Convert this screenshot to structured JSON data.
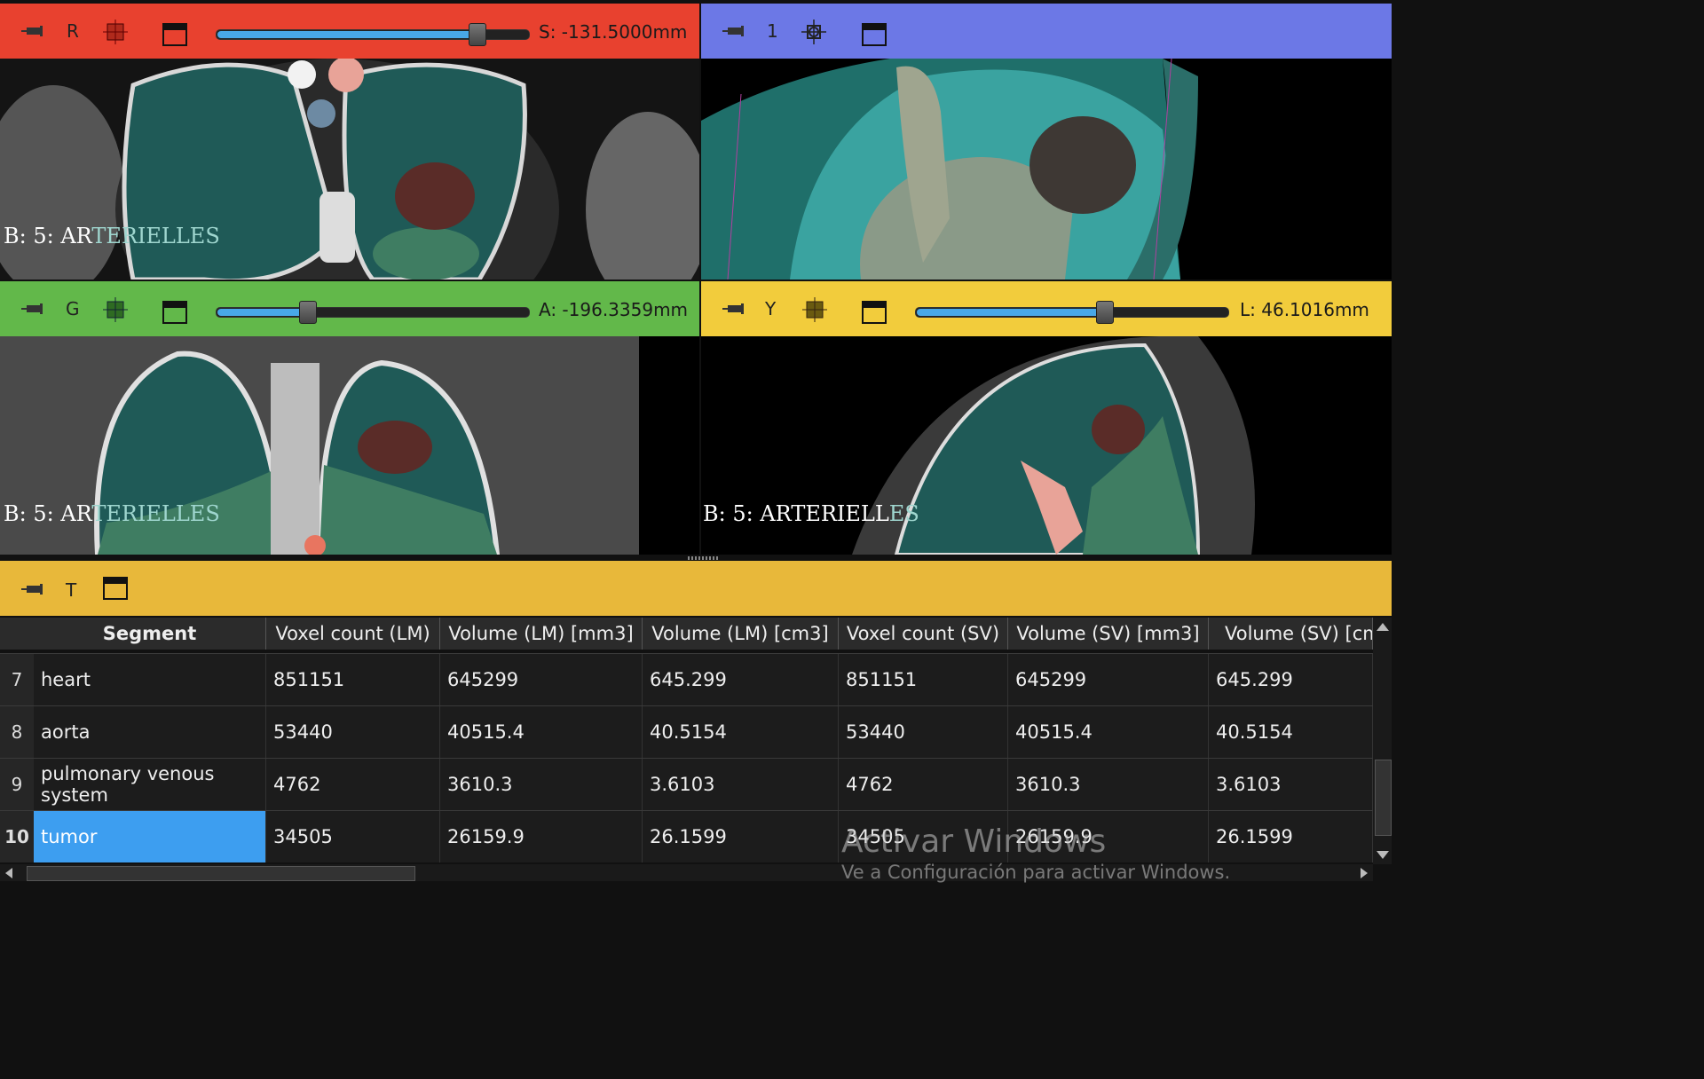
{
  "views": {
    "red": {
      "letter": "R",
      "readout": "S: -131.5000mm",
      "label_a": "B: 5: AR",
      "label_b": "TERIELLES",
      "slider_pos": 0.83
    },
    "threed": {
      "letter": "1"
    },
    "green": {
      "letter": "G",
      "readout": "A: -196.3359mm",
      "label_a": "B: 5: AR",
      "label_b": "TERIELLES",
      "slider_pos": 0.29
    },
    "yellow": {
      "letter": "Y",
      "readout": "L: 46.1016mm",
      "label_a": "B: 5: ARTERIELL",
      "label_b": "ES",
      "slider_pos": 0.6
    }
  },
  "table_view": {
    "letter": "T",
    "headers": [
      "Segment",
      "Voxel count (LM)",
      "Volume (LM) [mm3]",
      "Volume (LM) [cm3]",
      "Voxel count (SV)",
      "Volume (SV) [mm3]",
      "Volume (SV) [cm"
    ],
    "rows": [
      {
        "num": "7",
        "cells": [
          "heart",
          "851151",
          "645299",
          "645.299",
          "851151",
          "645299",
          "645.299"
        ]
      },
      {
        "num": "8",
        "cells": [
          "aorta",
          "53440",
          "40515.4",
          "40.5154",
          "53440",
          "40515.4",
          "40.5154"
        ]
      },
      {
        "num": "9",
        "cells": [
          "pulmonary venous system",
          "4762",
          "3610.3",
          "3.6103",
          "4762",
          "3610.3",
          "3.6103"
        ]
      },
      {
        "num": "10",
        "cells": [
          "tumor",
          "34505",
          "26159.9",
          "26.1599",
          "34505",
          "26159.9",
          "26.1599"
        ]
      }
    ],
    "selected_row": "10"
  },
  "watermark": {
    "line1": "Activar Windows",
    "line2": "Ve a Configuración para activar Windows."
  },
  "colors": {
    "red": "#e8412f",
    "blue": "#6c78e6",
    "green": "#62b84a",
    "yellow": "#f2cc3c",
    "selected": "#3d9ef0"
  }
}
